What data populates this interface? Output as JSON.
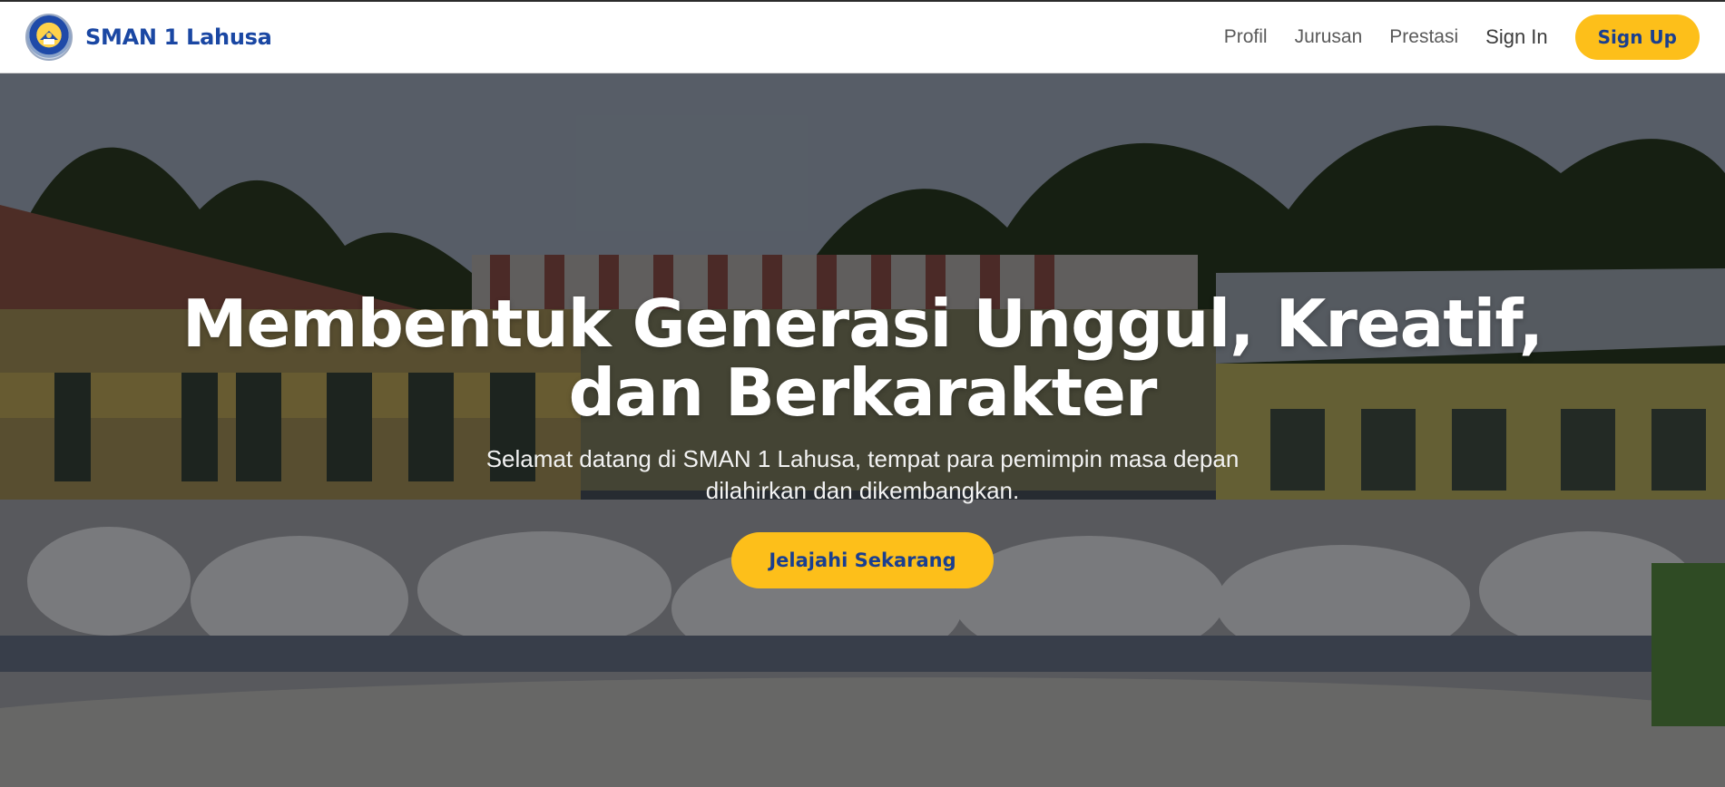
{
  "navbar": {
    "brand_name": "SMAN 1 Lahusa",
    "logo_icon": "school-emblem-icon",
    "links": [
      {
        "label": "Profil"
      },
      {
        "label": "Jurusan"
      },
      {
        "label": "Prestasi"
      },
      {
        "label": "Sign In"
      }
    ],
    "signup_label": "Sign Up"
  },
  "hero": {
    "title": "Membentuk Generasi Unggul, Kreatif, dan Berkarakter",
    "subtitle": "Selamat datang di SMAN 1 Lahusa, tempat para pemimpin masa depan dilahirkan dan dikembangkan.",
    "cta_label": "Jelajahi Sekarang"
  },
  "colors": {
    "brand_blue": "#1a47a3",
    "accent_yellow": "#fdbf1a",
    "button_text": "#1a3f8f"
  }
}
